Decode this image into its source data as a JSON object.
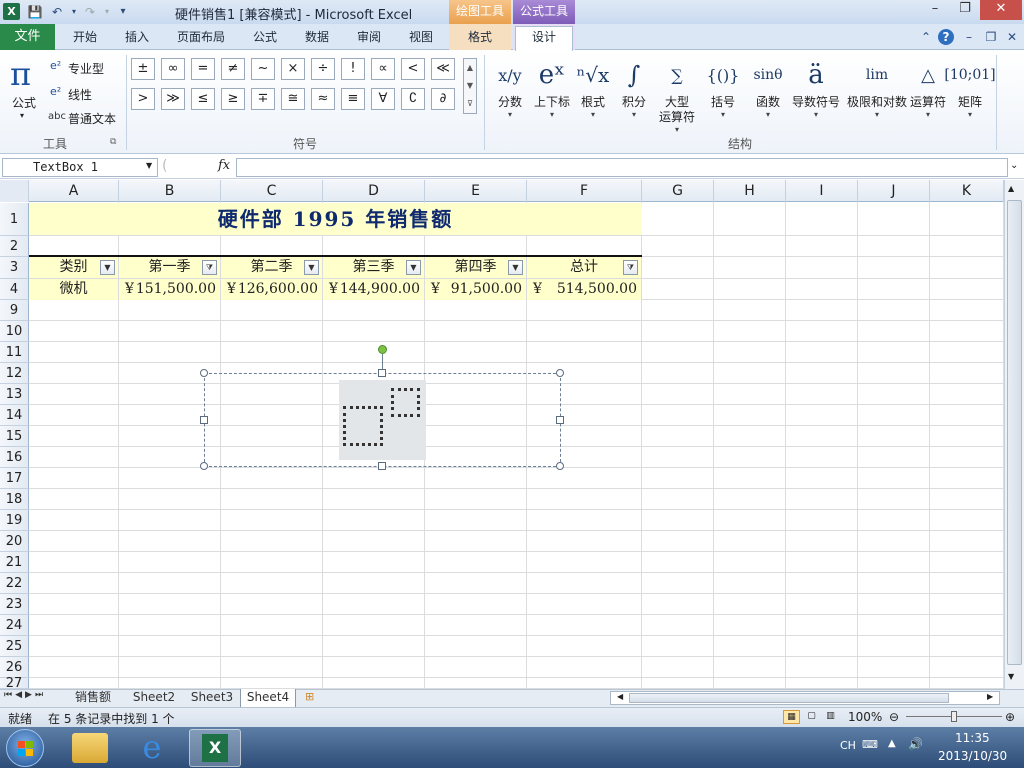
{
  "app": {
    "icon_letter": "X",
    "title": "硬件销售1  [兼容模式] - Microsoft Excel",
    "context_tab_drawing": "绘图工具",
    "context_tab_formula": "公式工具",
    "minimize": "–",
    "restore": "❐",
    "close": "✕"
  },
  "tabs": {
    "file": "文件",
    "home": "开始",
    "insert": "插入",
    "page_layout": "页面布局",
    "formulas": "公式",
    "data": "数据",
    "review": "审阅",
    "view": "视图",
    "format": "格式",
    "design": "设计"
  },
  "ribbon": {
    "tools": {
      "formula": "公式",
      "professional": "专业型",
      "linear": "线性",
      "normal_text": "普通文本",
      "group_label": "工具"
    },
    "symbols": {
      "row1": [
        "±",
        "∞",
        "=",
        "≠",
        "~",
        "×",
        "÷",
        "!",
        "∝",
        "<",
        "≪"
      ],
      "row2": [
        ">",
        "≫",
        "≤",
        "≥",
        "∓",
        "≅",
        "≈",
        "≡",
        "∀",
        "∁",
        "∂"
      ],
      "group_label": "符号"
    },
    "structures": {
      "items": [
        {
          "glyph": "x/y",
          "label": "分数"
        },
        {
          "glyph": "eˣ",
          "label": "上下标"
        },
        {
          "glyph": "ⁿ√x",
          "label": "根式"
        },
        {
          "glyph": "∫",
          "label": "积分"
        },
        {
          "glyph": "∑",
          "label": "大型运算符"
        },
        {
          "glyph": "{()}",
          "label": "括号"
        },
        {
          "glyph": "sinθ",
          "label": "函数"
        },
        {
          "glyph": "ä",
          "label": "导数符号"
        },
        {
          "glyph": "lim",
          "label": "极限和对数"
        },
        {
          "glyph": "△",
          "label": "运算符"
        },
        {
          "glyph": "[10;01]",
          "label": "矩阵"
        }
      ],
      "large_op_line1": "大型",
      "large_op_line2": "运算符",
      "group_label": "结构"
    }
  },
  "formula_bar": {
    "name_box": "TextBox 1",
    "fx": "fx",
    "content": ""
  },
  "grid": {
    "columns": [
      "A",
      "B",
      "C",
      "D",
      "E",
      "F",
      "G",
      "H",
      "I",
      "J",
      "K"
    ],
    "rows": [
      "1",
      "2",
      "3",
      "4",
      "9",
      "10",
      "11",
      "12",
      "13",
      "14",
      "15",
      "16",
      "17",
      "18",
      "19",
      "20",
      "21",
      "22",
      "23",
      "24",
      "25",
      "26",
      "27"
    ],
    "title": "硬件部 1995 年销售额",
    "headers": [
      "类别",
      "第一季",
      "第二季",
      "第三季",
      "第四季",
      "总计"
    ],
    "record": {
      "category": "微机",
      "currency": "¥",
      "q1": "151,500.00",
      "q2": "126,600.00",
      "q3": "144,900.00",
      "q4": "91,500.00",
      "total": "514,500.00"
    }
  },
  "sheets": {
    "tabs": [
      "销售额",
      "Sheet2",
      "Sheet3",
      "Sheet4"
    ],
    "active": "Sheet4"
  },
  "status": {
    "ready": "就绪",
    "filter_msg": "在 5 条记录中找到 1 个",
    "zoom": "100%"
  },
  "taskbar": {
    "lang": "CH",
    "time": "11:35",
    "date": "2013/10/30"
  },
  "colors": {
    "title_fill": "#ffffcc",
    "file_tab": "#2a8a4a",
    "drawing_tools": "#e9a04d",
    "formula_tools": "#7d5cb8"
  }
}
